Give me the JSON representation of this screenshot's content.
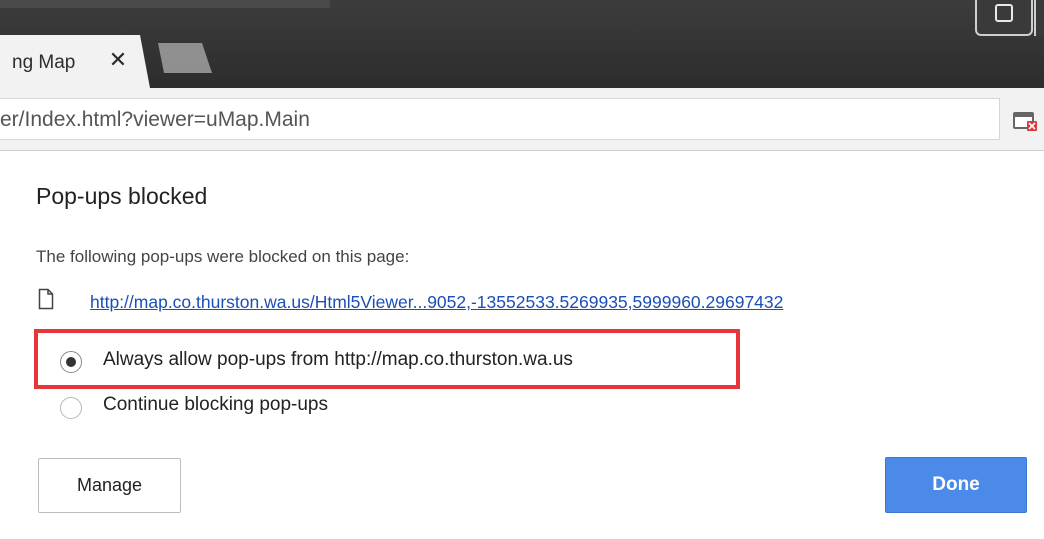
{
  "browser": {
    "tab": {
      "title": "ng Map",
      "close_glyph": "✕"
    },
    "address_bar": {
      "url_text": "er/Index.html?viewer=uMap.Main"
    },
    "icons": {
      "window_control": "user-profile-icon",
      "popup_blocked": "popup-blocked-icon",
      "page": "page-icon"
    }
  },
  "popup_bubble": {
    "title": "Pop-ups blocked",
    "description": "The following pop-ups were blocked on this page:",
    "blocked_link": "http://map.co.thurston.wa.us/Html5Viewer...9052,-13552533.5269935,5999960.29697432",
    "options": [
      {
        "label": "Always allow pop-ups from http://map.co.thurston.wa.us",
        "selected": true
      },
      {
        "label": "Continue blocking pop-ups",
        "selected": false
      }
    ],
    "manage_label": "Manage",
    "done_label": "Done"
  },
  "colors": {
    "highlight": "#e8353b",
    "done_button": "#4b8ae8",
    "link": "#1a4fb8",
    "titlebar": "#2d2d2d"
  }
}
